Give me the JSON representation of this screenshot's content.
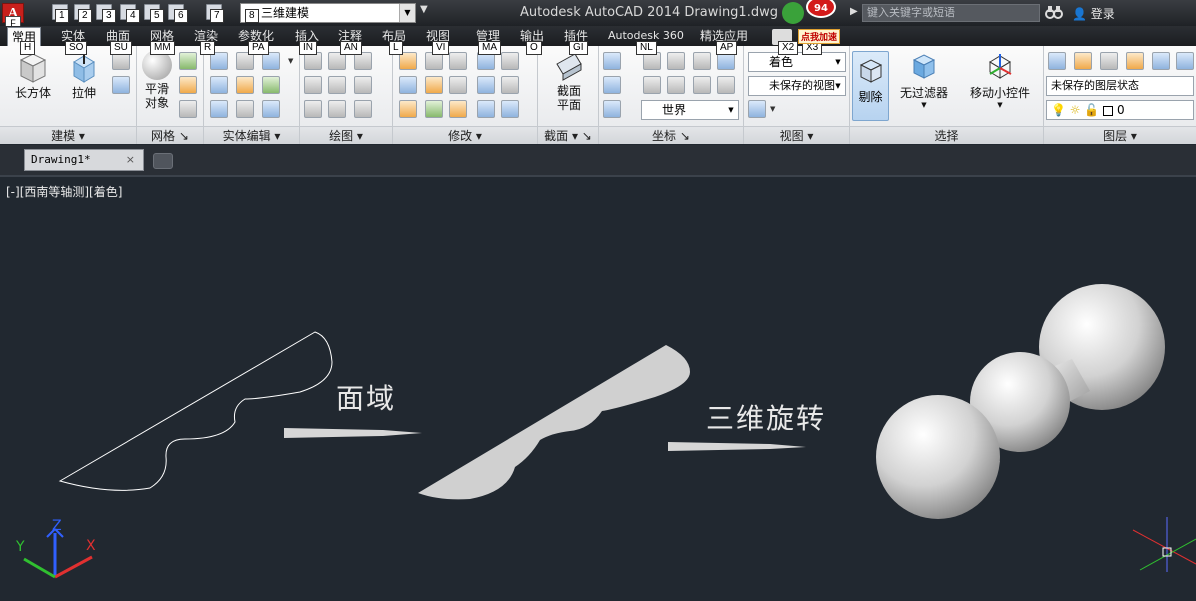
{
  "titlebar": {
    "app_key": "A",
    "app_menu_key_tip": "F",
    "workspace": "三维建模",
    "title": "Autodesk AutoCAD 2014    Drawing1.dwg",
    "notification_count": "94",
    "speedup_label": "点我加速",
    "search_placeholder": "键入关键字或短语",
    "login_label": "登录",
    "qa_keytips": [
      "1",
      "2",
      "3",
      "4",
      "5",
      "6",
      "7",
      "8"
    ]
  },
  "ribbon_tabs": [
    {
      "label": "常用",
      "key": "H"
    },
    {
      "label": "实体",
      "key": "SO"
    },
    {
      "label": "曲面",
      "key": "SU"
    },
    {
      "label": "网格",
      "key": "MM"
    },
    {
      "label": "渲染",
      "key": "R"
    },
    {
      "label": "参数化",
      "key": "PA"
    },
    {
      "label": "插入",
      "key": "IN"
    },
    {
      "label": "注释",
      "key": "AN"
    },
    {
      "label": "布局",
      "key": "L"
    },
    {
      "label": "视图",
      "key": "VI"
    },
    {
      "label": "管理",
      "key": "MA"
    },
    {
      "label": "输出",
      "key": "O"
    },
    {
      "label": "插件",
      "key": "GI"
    },
    {
      "label": "Autodesk 360",
      "key": "NL"
    },
    {
      "label": "精选应用",
      "key": "AP"
    },
    {
      "label": "",
      "key": "X2"
    },
    {
      "label": "",
      "key": "X3"
    }
  ],
  "panels": {
    "modeling": {
      "title": "建模",
      "box_label": "长方体",
      "extrude_label": "拉伸"
    },
    "mesh": {
      "title": "网格",
      "smooth_label": "平滑\n对象"
    },
    "solid_edit": {
      "title": "实体编辑"
    },
    "draw": {
      "title": "绘图"
    },
    "modify": {
      "title": "修改"
    },
    "section": {
      "title": "截面",
      "plane_label": "截面\n平面"
    },
    "coordinates": {
      "title": "坐标",
      "ucs_world": "世界"
    },
    "view": {
      "title": "视图",
      "visual_style": "着色",
      "named_view": "未保存的视图"
    },
    "selection": {
      "title": "选择",
      "cull_label": "剔除",
      "no_filter_label": "无过滤器",
      "gizmo_label": "移动小控件"
    },
    "layers": {
      "title": "图层",
      "layer_state": "未保存的图层状态",
      "layer_name": "0"
    }
  },
  "document_tab": {
    "name": "Drawing1*",
    "close": "×"
  },
  "viewport": {
    "label": "[-][西南等轴测][着色]",
    "annotation_region": "面域",
    "annotation_revolve": "三维旋转"
  },
  "ucs_axes": {
    "x": "X",
    "y": "Y",
    "z": "Z"
  },
  "colors": {
    "canvas": "#212830",
    "line": "#ffffff",
    "region_fill": "#d0d0d0",
    "axis_x": "#e03030",
    "axis_y": "#30c030",
    "axis_z": "#3060ff"
  }
}
